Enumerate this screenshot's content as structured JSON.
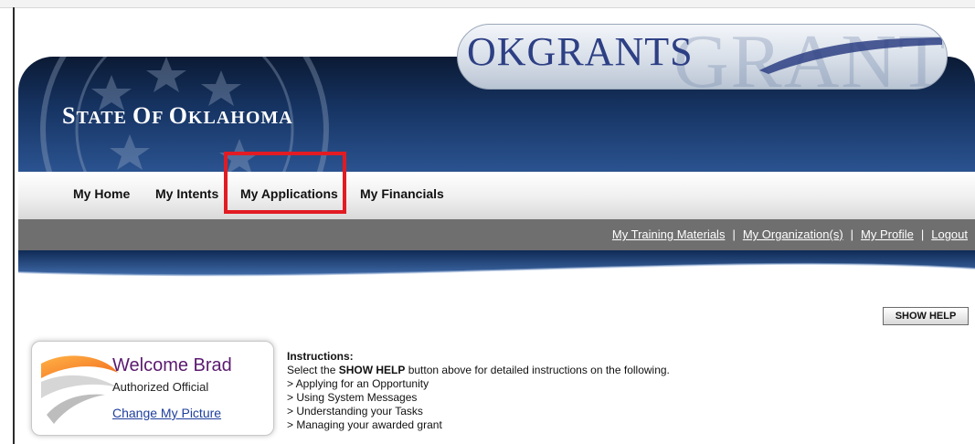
{
  "header": {
    "state_title": "State of Oklahoma",
    "logo_text": "OKGRANTS",
    "logo_ghost_text": "GRANTS"
  },
  "nav": {
    "items": [
      {
        "label": "My Home"
      },
      {
        "label": "My Intents"
      },
      {
        "label": "My Applications"
      },
      {
        "label": "My Financials"
      }
    ]
  },
  "util_links": {
    "items": [
      "My Training Materials",
      "My Organization(s)",
      "My Profile",
      "Logout"
    ],
    "separator": "|"
  },
  "help": {
    "show_help_label": "SHOW HELP"
  },
  "welcome": {
    "name": "Welcome Brad",
    "role": "Authorized Official",
    "change_picture": "Change My Picture"
  },
  "instructions": {
    "title": "Instructions:",
    "intro_prefix": "Select the ",
    "intro_emphasis": "SHOW HELP",
    "intro_suffix": " button above for detailed instructions on the following.",
    "items": [
      "> Applying for an Opportunity",
      "> Using System Messages",
      "> Understanding your Tasks",
      "> Managing your awarded grant"
    ]
  },
  "colors": {
    "highlight": "#e21b23",
    "banner": "#163463",
    "util_bar": "#6f6f6f",
    "welcome_name": "#5b1a6f",
    "link": "#1f3f9e"
  }
}
